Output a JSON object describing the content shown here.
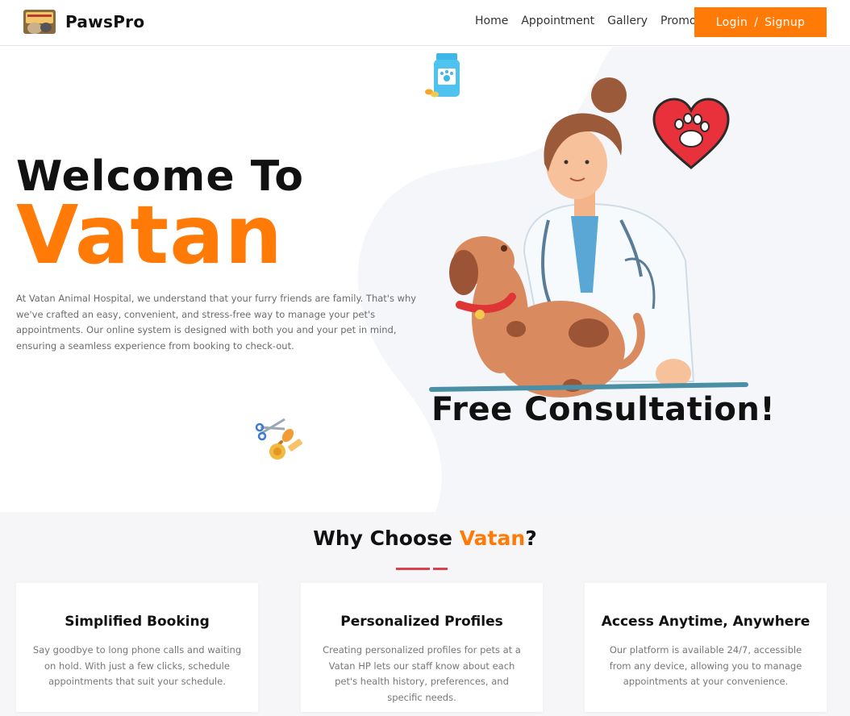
{
  "nav": {
    "brand": "PawsPro",
    "links": [
      "Home",
      "Appointment",
      "Gallery",
      "Promos"
    ],
    "login_label": "Login",
    "signup_label": "Signup"
  },
  "hero": {
    "title_line1": "Welcome To",
    "title_line2": "Vatan",
    "description": "At Vatan Animal Hospital, we understand that your furry friends are family. That's why we've crafted an easy, convenient, and stress-free way to manage your pet's appointments. Our online system is designed with both you and your pet in mind, ensuring a seamless experience from booking to check-out.",
    "banner": "Free Consultation!"
  },
  "why": {
    "title_prefix": "Why Choose ",
    "title_accent": "Vatan",
    "title_suffix": "?",
    "cards": [
      {
        "title": "Simplified Booking",
        "text": "Say goodbye to long phone calls and waiting on hold. With just a few clicks, schedule appointments that suit your schedule."
      },
      {
        "title": "Personalized Profiles",
        "text": "Creating personalized profiles for pets at a Vatan HP lets our staff know about each pet's health history, preferences, and specific needs."
      },
      {
        "title": "Access Anytime, Anywhere",
        "text": "Our platform is available 24/7, accessible from any device, allowing you to manage appointments at your convenience."
      }
    ]
  },
  "colors": {
    "accent": "#ff7a06",
    "underline": "#d9414e",
    "section_bg": "#f6f6f8"
  },
  "icons": [
    "logo-icon",
    "medicine-bottle-icon",
    "paw-heart-icon",
    "grooming-tools-icon",
    "vet-with-dog-illustration"
  ]
}
